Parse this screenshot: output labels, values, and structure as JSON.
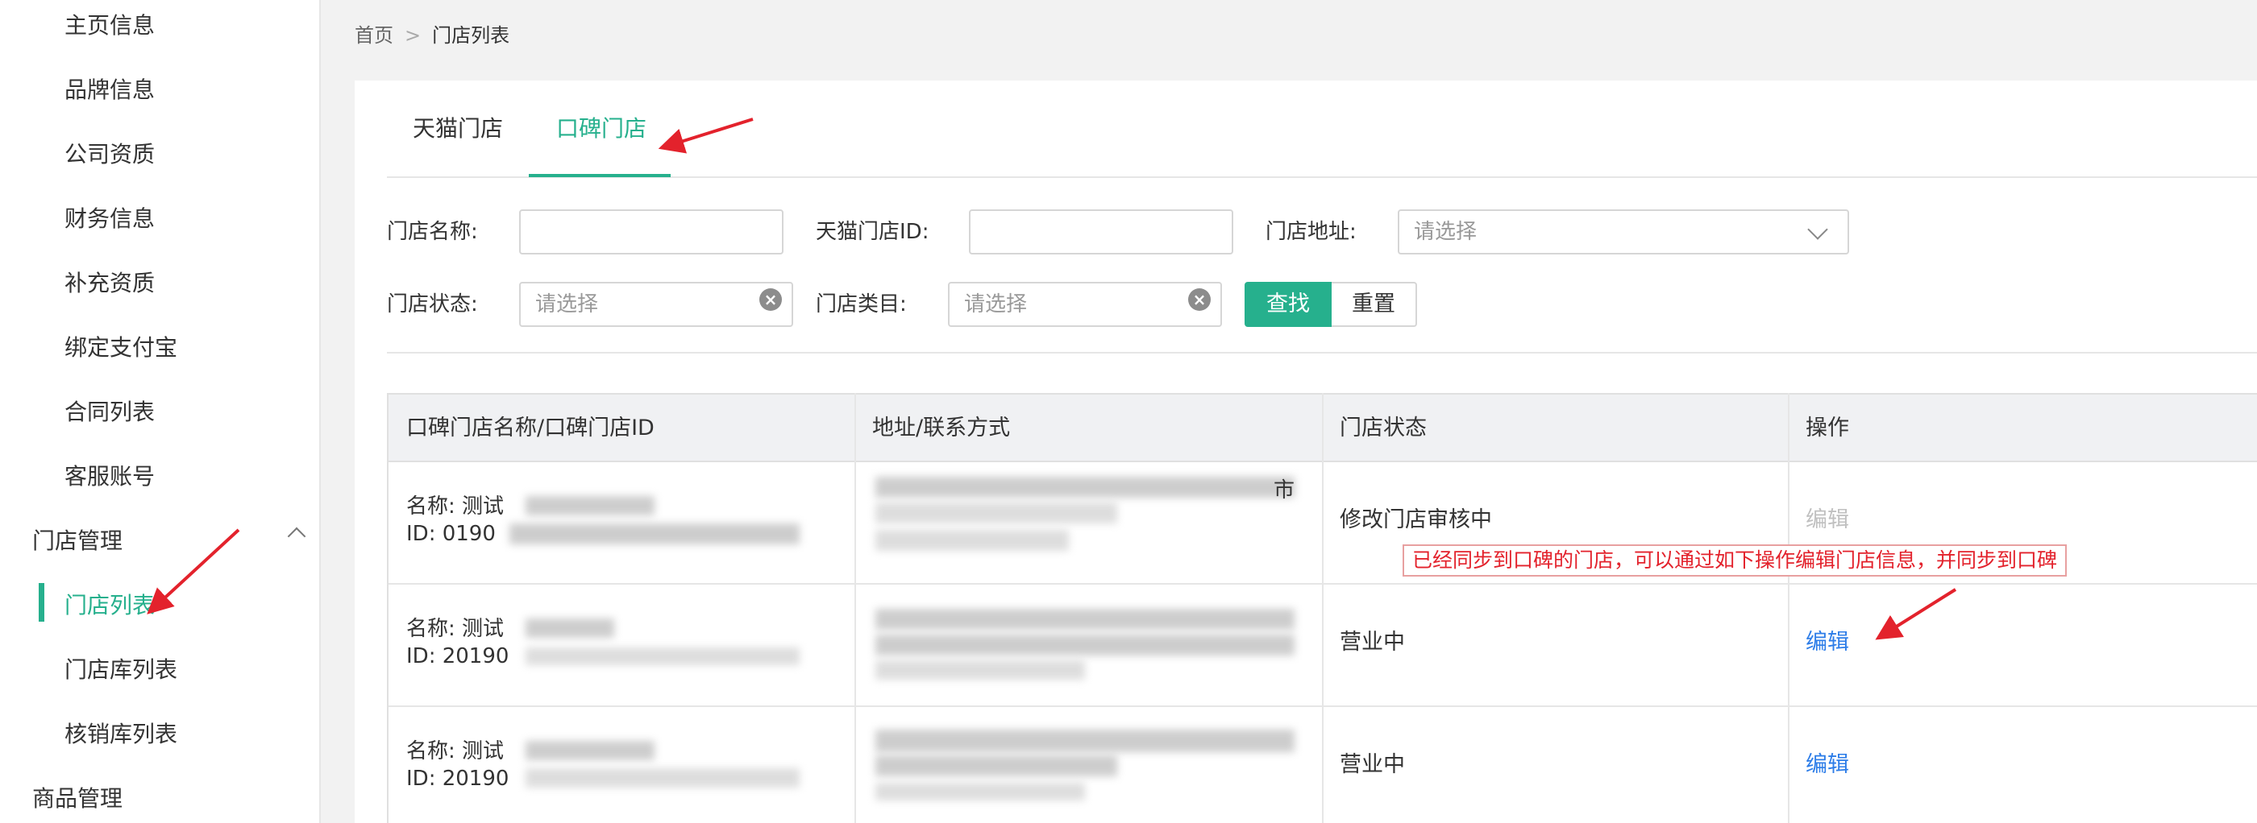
{
  "sidebar": {
    "items": [
      {
        "label": "主页信息"
      },
      {
        "label": "品牌信息"
      },
      {
        "label": "公司资质"
      },
      {
        "label": "财务信息"
      },
      {
        "label": "补充资质"
      },
      {
        "label": "绑定支付宝"
      },
      {
        "label": "合同列表"
      },
      {
        "label": "客服账号"
      }
    ],
    "group_store": {
      "label": "门店管理",
      "icon": "chevron-up-icon"
    },
    "store_items": [
      {
        "label": "门店列表",
        "active": true
      },
      {
        "label": "门店库列表"
      },
      {
        "label": "核销库列表"
      }
    ],
    "group_goods": {
      "label": "商品管理"
    },
    "active_color": "#26b08d"
  },
  "breadcrumb": {
    "home": "首页",
    "separator": ">",
    "current": "门店列表"
  },
  "tabs": [
    {
      "label": "天猫门店",
      "active": false
    },
    {
      "label": "口碑门店",
      "active": true
    }
  ],
  "filters": {
    "store_name": {
      "label": "门店名称:",
      "value": ""
    },
    "tmall_id": {
      "label": "天猫门店ID:",
      "value": ""
    },
    "address": {
      "label": "门店地址:",
      "placeholder": "请选择"
    },
    "status": {
      "label": "门店状态:",
      "placeholder": "请选择"
    },
    "category": {
      "label": "门店类目:",
      "placeholder": "请选择"
    },
    "search_button": "查找",
    "reset_button": "重置"
  },
  "table": {
    "headers": [
      "口碑门店名称/口碑门店ID",
      "地址/联系方式",
      "门店状态",
      "操作"
    ],
    "rows": [
      {
        "name_line": "名称: 测试",
        "id_line": "ID: 0190",
        "address_tail": "市",
        "status": "修改门店审核中",
        "action": "编辑",
        "action_enabled": false
      },
      {
        "name_line": "名称: 测试",
        "id_line": "ID: 20190",
        "address_tail": "",
        "status": "营业中",
        "action": "编辑",
        "action_enabled": true
      },
      {
        "name_line": "名称: 测试",
        "id_line": "ID: 20190",
        "address_tail": "",
        "status": "营业中",
        "action": "编辑",
        "action_enabled": true
      }
    ]
  },
  "annotation": {
    "text": "已经同步到口碑的门店，可以通过如下操作编辑门店信息，并同步到口碑",
    "color": "#e3222c"
  },
  "colors": {
    "primary": "#26b08d",
    "link": "#2d7de8",
    "annotation_red": "#e3222c"
  }
}
